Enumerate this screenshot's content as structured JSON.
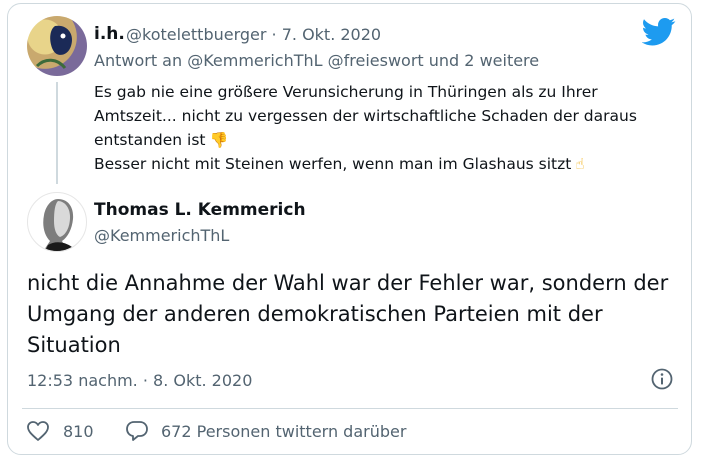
{
  "reply_tweet": {
    "display_name": "i.h.",
    "meta": "@kotelettbuerger · 7. Okt. 2020",
    "replying_to": "Antwort an @KemmerichThL @freieswort und 2 weitere",
    "lines": [
      "Es gab nie eine größere Verunsicherung in Thüringen als zu Ihrer",
      "Amtszeit... nicht zu vergessen der wirtschaftliche Schaden der daraus",
      "entstanden ist",
      "Besser nicht mit Steinen werfen, wenn man im Glashaus sitzt"
    ],
    "emoji_1": "thumbs-down-emoji",
    "emoji_2": "pointing-up-emoji"
  },
  "main_tweet": {
    "display_name": "Thomas L. Kemmerich",
    "handle": "@KemmerichThL",
    "lines": [
      "nicht die Annahme der Wahl war der Fehler war, sondern der",
      "Umgang der anderen demokratischen Parteien mit der",
      "Situation"
    ],
    "timestamp": "12:53 nachm. · 8. Okt. 2020"
  },
  "actions": {
    "likes": "810",
    "replies": "672 Personen twittern darüber"
  },
  "icons": {
    "brand": "twitter-bird-icon",
    "info": "info-icon",
    "like": "heart-icon",
    "reply": "speech-bubble-icon"
  },
  "colors": {
    "brand": "#1d9bf0",
    "text": "#0f1419",
    "secondary": "#536471",
    "border": "#cfd9de"
  }
}
